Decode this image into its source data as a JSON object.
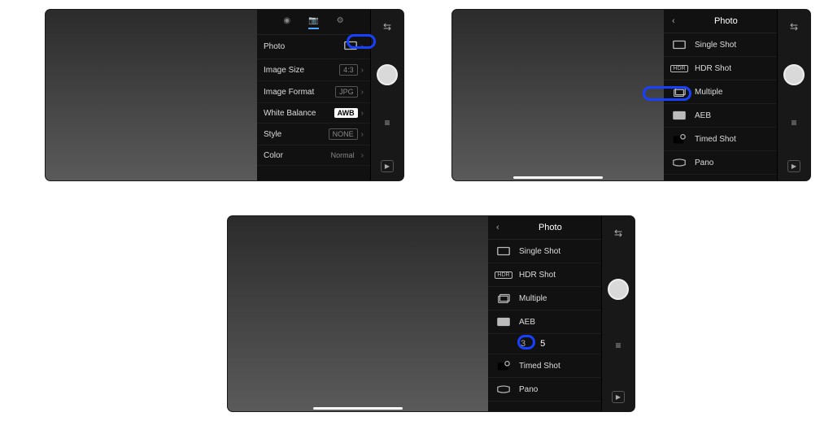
{
  "screen1": {
    "tabs": {
      "exposure": "◉",
      "camera": "📷",
      "settings": "⚙"
    },
    "rows": {
      "photo": {
        "label": "Photo",
        "value": ""
      },
      "image_size": {
        "label": "Image Size",
        "value": "4:3"
      },
      "image_format": {
        "label": "Image Format",
        "value": "JPG"
      },
      "white_balance": {
        "label": "White Balance",
        "value": "AWB"
      },
      "style": {
        "label": "Style",
        "value": "NONE"
      },
      "color": {
        "label": "Color",
        "value": "Normal"
      }
    },
    "side": {
      "swap": "⇆",
      "sliders": "≡",
      "play": "▶"
    }
  },
  "screen2": {
    "header": {
      "back": "‹",
      "title": "Photo"
    },
    "modes": {
      "single": "Single Shot",
      "hdr": "HDR Shot",
      "multiple": "Multiple",
      "aeb": "AEB",
      "timed": "Timed Shot",
      "pano": "Pano"
    },
    "hdr_badge": "HDR",
    "side": {
      "swap": "⇆",
      "sliders": "≡",
      "play": "▶"
    }
  },
  "screen3": {
    "header": {
      "back": "‹",
      "title": "Photo"
    },
    "modes": {
      "single": "Single Shot",
      "hdr": "HDR Shot",
      "multiple": "Multiple",
      "aeb": "AEB",
      "timed": "Timed Shot",
      "pano": "Pano"
    },
    "hdr_badge": "HDR",
    "aeb_options": {
      "opt3": "3",
      "opt5": "5"
    },
    "side": {
      "swap": "⇆",
      "sliders": "≡",
      "play": "▶"
    }
  }
}
